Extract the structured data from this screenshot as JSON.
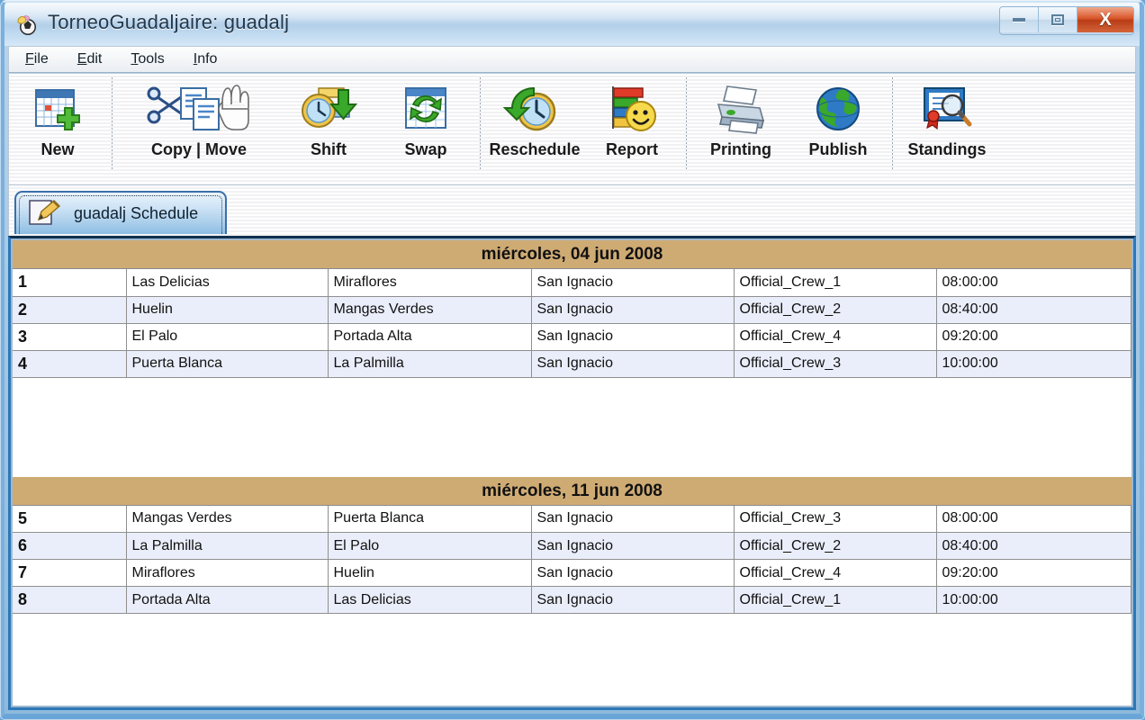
{
  "window": {
    "title": "TorneoGuadaljaire: guadalj",
    "app_icon": "app-ball-icon",
    "caption": {
      "minimize": "Minimize",
      "maximize": "Maximize",
      "close": "X"
    }
  },
  "menubar": {
    "items": [
      {
        "label": "File",
        "mnemonic": "F"
      },
      {
        "label": "Edit",
        "mnemonic": "E"
      },
      {
        "label": "Tools",
        "mnemonic": "T"
      },
      {
        "label": "Info",
        "mnemonic": "I"
      }
    ]
  },
  "toolbar": {
    "buttons": [
      {
        "label": "New",
        "icon": "calendar-plus-icon"
      },
      {
        "label": "Copy | Move",
        "icon": "scissors-documents-hand-icon"
      },
      {
        "label": "Shift",
        "icon": "clock-down-arrow-icon"
      },
      {
        "label": "Swap",
        "icon": "grid-recycle-arrows-icon"
      },
      {
        "label": "Reschedule",
        "icon": "clock-back-arrow-icon"
      },
      {
        "label": "Report",
        "icon": "bar-chart-smiley-icon"
      },
      {
        "label": "Printing",
        "icon": "printer-icon"
      },
      {
        "label": "Publish",
        "icon": "globe-icon"
      },
      {
        "label": "Standings",
        "icon": "certificate-magnifier-icon"
      }
    ]
  },
  "tabs": [
    {
      "label": "guadalj  Schedule",
      "icon": "pencil-edit-icon",
      "selected": true
    }
  ],
  "schedule": {
    "groups": [
      {
        "date": "miércoles, 04 jun 2008",
        "matches": [
          {
            "num": "1",
            "home": "Las Delicias",
            "away": "Miraflores",
            "venue": "San Ignacio",
            "crew": "Official_Crew_1",
            "time": "08:00:00"
          },
          {
            "num": "2",
            "home": "Huelin",
            "away": "Mangas Verdes",
            "venue": "San Ignacio",
            "crew": "Official_Crew_2",
            "time": "08:40:00"
          },
          {
            "num": "3",
            "home": "El Palo",
            "away": "Portada Alta",
            "venue": "San Ignacio",
            "crew": "Official_Crew_4",
            "time": "09:20:00"
          },
          {
            "num": "4",
            "home": "Puerta Blanca",
            "away": "La Palmilla",
            "venue": "San Ignacio",
            "crew": "Official_Crew_3",
            "time": "10:00:00"
          }
        ]
      },
      {
        "date": "miércoles, 11 jun 2008",
        "matches": [
          {
            "num": "5",
            "home": "Mangas Verdes",
            "away": "Puerta Blanca",
            "venue": "San Ignacio",
            "crew": "Official_Crew_3",
            "time": "08:00:00"
          },
          {
            "num": "6",
            "home": "La Palmilla",
            "away": "El Palo",
            "venue": "San Ignacio",
            "crew": "Official_Crew_2",
            "time": "08:40:00"
          },
          {
            "num": "7",
            "home": "Miraflores",
            "away": "Huelin",
            "venue": "San Ignacio",
            "crew": "Official_Crew_4",
            "time": "09:20:00"
          },
          {
            "num": "8",
            "home": "Portada Alta",
            "away": "Las Delicias",
            "venue": "San Ignacio",
            "crew": "Official_Crew_1",
            "time": "10:00:00"
          }
        ]
      }
    ]
  },
  "colors": {
    "group_header_bg": "#cfab74",
    "row_alt_bg": "#eaeefa",
    "panel_border": "#2b78b8",
    "tab_border": "#3b6ea8",
    "close_button": "#c4441a"
  }
}
